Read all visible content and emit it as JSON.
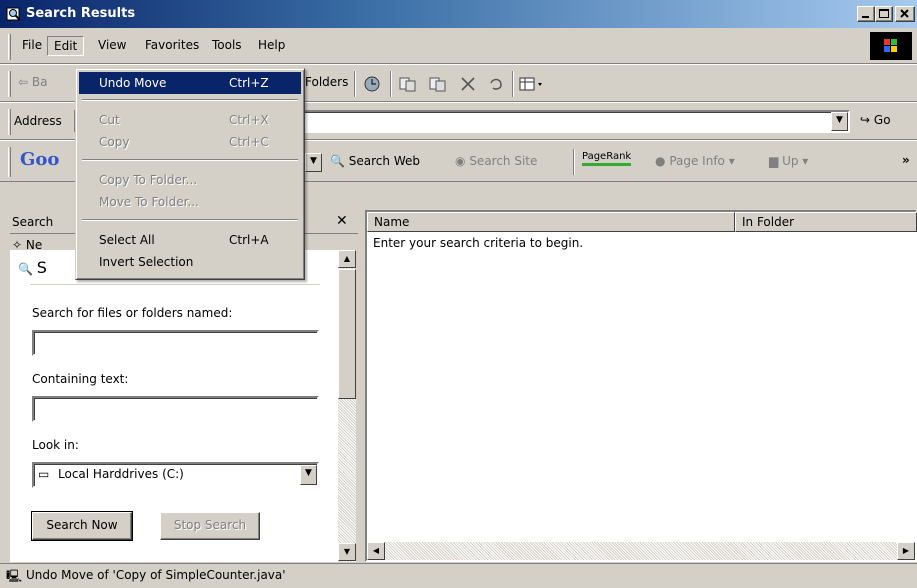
{
  "window": {
    "title": "Search Results"
  },
  "menu": [
    "File",
    "Edit",
    "View",
    "Favorites",
    "Tools",
    "Help"
  ],
  "toolbar": {
    "back_label": "Ba",
    "folders_label": "Folders"
  },
  "address": {
    "label": "Address",
    "go_label": "Go"
  },
  "google_bar": {
    "logo": "Goo",
    "search_web": "Search Web",
    "search_site": "Search Site",
    "pagerank": "PageRank",
    "page_info": "Page Info",
    "up": "Up",
    "more": "»"
  },
  "edit_menu": {
    "items": [
      {
        "label": "Undo Move",
        "shortcut": "Ctrl+Z",
        "state": "highlighted"
      },
      {
        "label": "Cut",
        "shortcut": "Ctrl+X",
        "state": "disabled"
      },
      {
        "label": "Copy",
        "shortcut": "Ctrl+C",
        "state": "disabled"
      },
      {
        "label": "Copy To Folder...",
        "shortcut": "",
        "state": "disabled"
      },
      {
        "label": "Move To Folder...",
        "shortcut": "",
        "state": "disabled"
      },
      {
        "label": "Select All",
        "shortcut": "Ctrl+A",
        "state": "enabled"
      },
      {
        "label": "Invert Selection",
        "shortcut": "",
        "state": "enabled"
      }
    ]
  },
  "search_pane": {
    "title": "Search",
    "new_label": "Ne",
    "heading": "S",
    "files_label": "Search for files or folders named:",
    "files_value": "",
    "containing_label": "Containing text:",
    "containing_value": "",
    "look_in_label": "Look in:",
    "look_in_value": "Local Harddrives (C:)",
    "search_now": "Search Now",
    "stop_search": "Stop Search"
  },
  "results": {
    "columns": [
      "Name",
      "In Folder"
    ],
    "empty_message": "Enter your search criteria to begin."
  },
  "status": {
    "text": "Undo Move of 'Copy of SimpleCounter.java'"
  }
}
